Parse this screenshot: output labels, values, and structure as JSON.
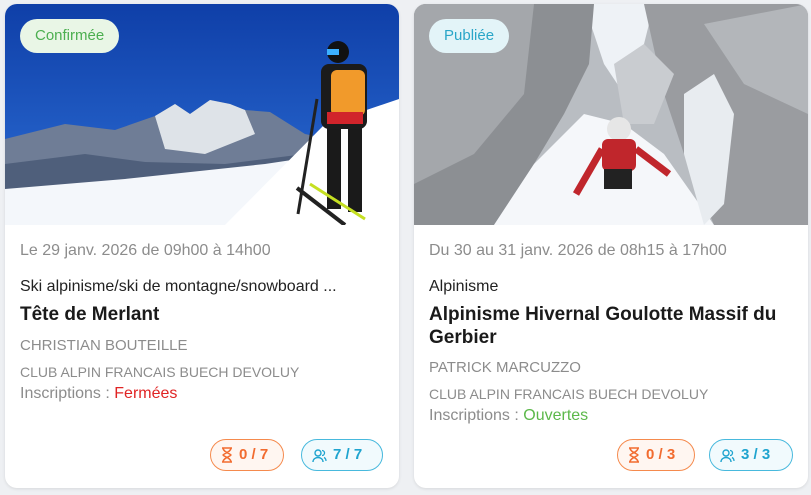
{
  "cards": [
    {
      "badge": "Confirmée",
      "date": "Le 29 janv. 2026 de 09h00 à 14h00",
      "activity": "Ski alpinisme/ski de montagne/snowboard ...",
      "title": "Tête de Merlant",
      "leader": "CHRISTIAN BOUTEILLE",
      "club": "CLUB ALPIN FRANCAIS BUECH DEVOLUY",
      "inscriptions_label": "Inscriptions : ",
      "inscriptions_status": "Fermées",
      "waitlist": "0 / 7",
      "registered": "7 / 7",
      "photo": "skier-on-snowy-ridge"
    },
    {
      "badge": "Publiée",
      "date": "Du 30 au 31 janv. 2026 de 08h15 à 17h00",
      "activity": "Alpinisme",
      "title": "Alpinisme Hivernal Goulotte Massif du Gerbier",
      "leader": "PATRICK MARCUZZO",
      "club": "CLUB ALPIN FRANCAIS BUECH DEVOLUY",
      "inscriptions_label": "Inscriptions : ",
      "inscriptions_status": "Ouvertes",
      "waitlist": "0 / 3",
      "registered": "3 / 3",
      "photo": "climber-in-rocky-gully"
    }
  ],
  "icons": {
    "waitlist": "hourglass-icon",
    "registered": "users-icon"
  },
  "colors": {
    "confirmed": "#4caf50",
    "published": "#2aa6c8",
    "closed": "#e02424",
    "open": "#5cb84a",
    "waitlist": "#f26b2f",
    "registered": "#1fa4cf"
  }
}
